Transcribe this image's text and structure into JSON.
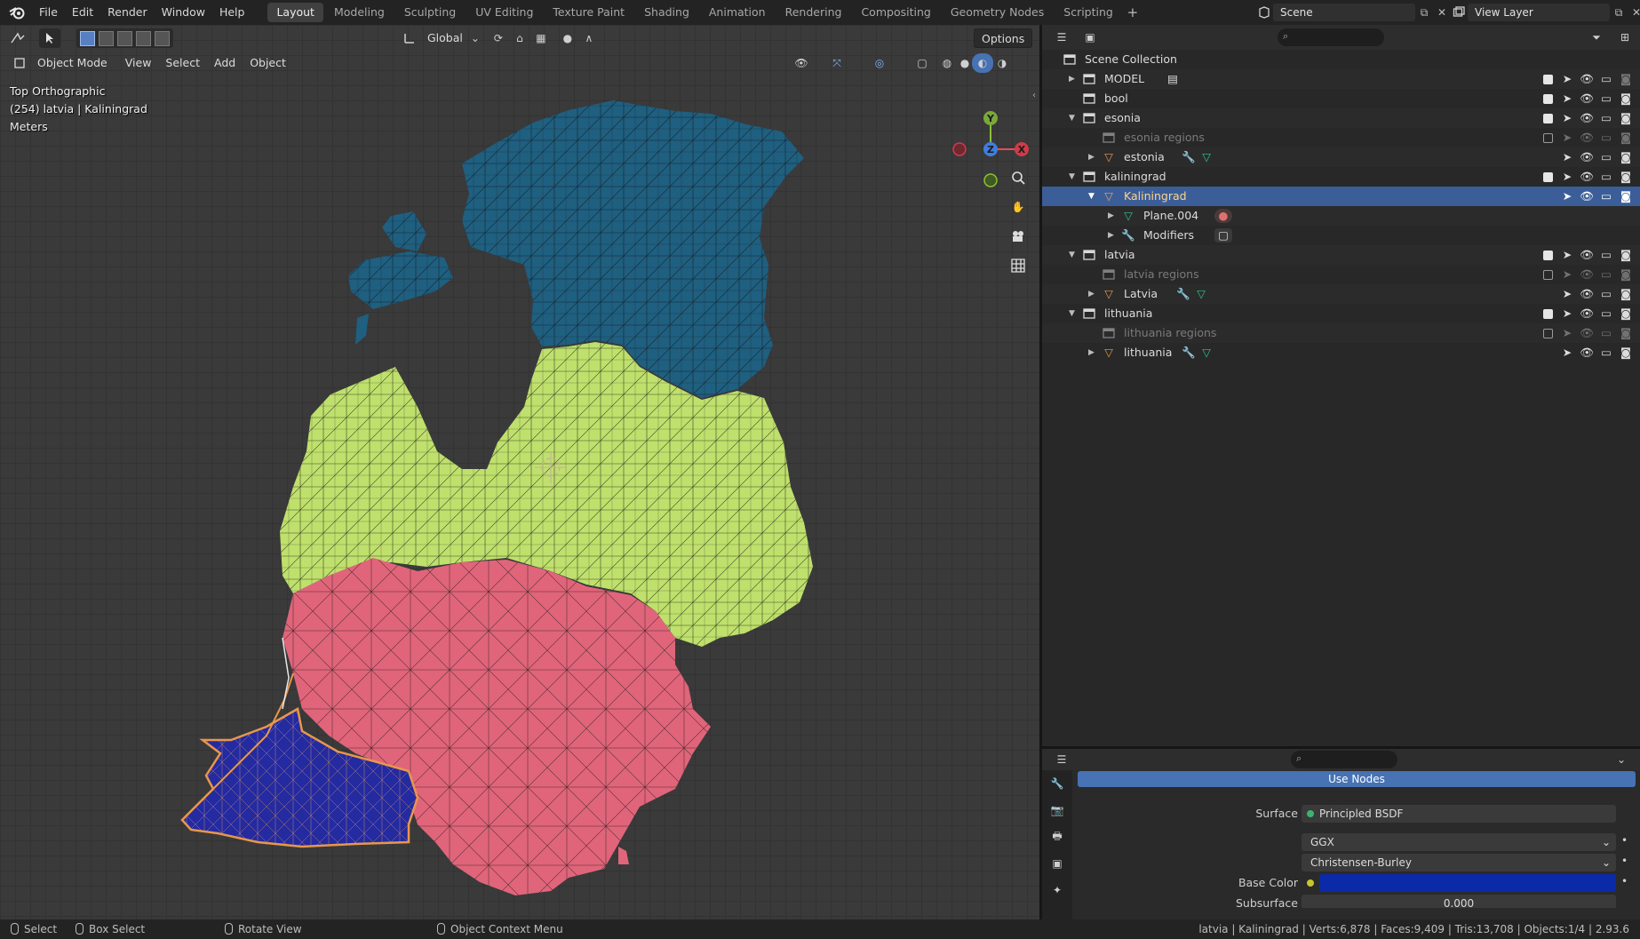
{
  "menu": [
    "File",
    "Edit",
    "Render",
    "Window",
    "Help"
  ],
  "workspaces": [
    "Layout",
    "Modeling",
    "Sculpting",
    "UV Editing",
    "Texture Paint",
    "Shading",
    "Animation",
    "Rendering",
    "Compositing",
    "Geometry Nodes",
    "Scripting"
  ],
  "active_workspace": "Layout",
  "scene": {
    "name": "Scene",
    "view_layer": "View Layer"
  },
  "viewport": {
    "transform_orientation": "Global",
    "options_label": "Options",
    "mode": "Object Mode",
    "header_menus": [
      "View",
      "Select",
      "Add",
      "Object"
    ],
    "overlay_view": "Top Orthographic",
    "overlay_object": "(254) latvia | Kaliningrad",
    "overlay_units": "Meters",
    "gizmo": {
      "x": "X",
      "y": "Y",
      "z": "Z"
    },
    "region_colors": {
      "estonia": "#1f5f80",
      "latvia": "#bfe06c",
      "lithuania": "#e0657a",
      "kaliningrad": "#242aa0",
      "selection_outline": "#e8974c"
    }
  },
  "outliner": {
    "root": "Scene Collection",
    "rows": [
      {
        "label": "MODEL",
        "type": "collection"
      },
      {
        "label": "bool",
        "type": "collection"
      },
      {
        "label": "esonia",
        "type": "collection"
      },
      {
        "label": "esonia regions",
        "type": "collection"
      },
      {
        "label": "estonia",
        "type": "object"
      },
      {
        "label": "kaliningrad",
        "type": "collection"
      },
      {
        "label": "Kaliningrad",
        "type": "object"
      },
      {
        "label": "Plane.004",
        "type": "mesh"
      },
      {
        "label": "Modifiers",
        "type": "modifiers"
      },
      {
        "label": "latvia",
        "type": "collection"
      },
      {
        "label": "latvia regions",
        "type": "collection"
      },
      {
        "label": "Latvia",
        "type": "object"
      },
      {
        "label": "lithuania",
        "type": "collection"
      },
      {
        "label": "lithuania regions",
        "type": "collection"
      },
      {
        "label": "lithuania",
        "type": "object"
      }
    ]
  },
  "properties": {
    "use_nodes": "Use Nodes",
    "surface_label": "Surface",
    "surface_value": "Principled BSDF",
    "distribution": "GGX",
    "subsurface_method": "Christensen-Burley",
    "base_color_label": "Base Color",
    "base_color": "#0b2aa8",
    "subsurface_label": "Subsurface",
    "subsurface_value": "0.000"
  },
  "statusbar": {
    "select": "Select",
    "box_select": "Box Select",
    "rotate_view": "Rotate View",
    "context_menu": "Object Context Menu",
    "stats": "latvia | Kaliningrad | Verts:6,878 | Faces:9,409 | Tris:13,708 | Objects:1/4 | 2.93.6"
  }
}
